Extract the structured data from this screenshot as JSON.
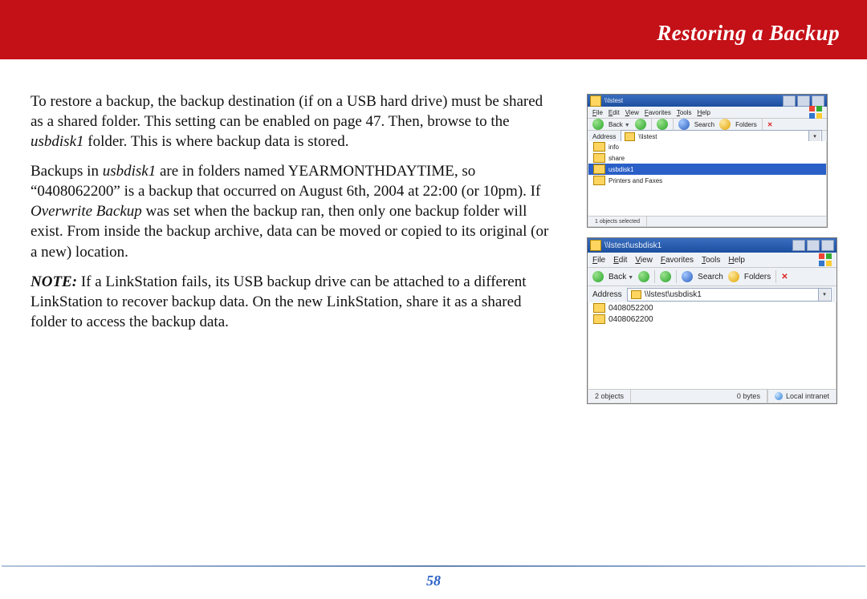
{
  "header": {
    "title": "Restoring a Backup"
  },
  "para1": {
    "a": "To restore a backup, the backup destination (if on a USB hard drive) must be shared as a shared folder.  This setting can be enabled on page 47.  Then, browse to the ",
    "b": "usbdisk1",
    "c": " folder.  This is where backup data is stored."
  },
  "para2": {
    "a": "Backups in ",
    "b": "usbdisk1",
    "c": " are in folders named YEARMONTHDAYTIME, so “0408062200” is a backup that occurred on August 6th, 2004 at 22:00 (or 10pm).  If ",
    "d": "Overwrite Backup",
    "e": " was set when the backup ran, then only one backup folder will exist.  From inside the backup archive, data can be moved or copied to its original (or a new) location."
  },
  "para3": {
    "a": "NOTE:",
    "b": "  If a LinkStation fails, its USB backup drive can be attached to a different LinkStation to recover backup data.  On the new LinkStation, share it as a shared folder to access the backup data."
  },
  "screenshot1": {
    "title": "\\\\lstest",
    "menu": [
      "File",
      "Edit",
      "View",
      "Favorites",
      "Tools",
      "Help"
    ],
    "tb": {
      "back": "Back",
      "search": "Search",
      "folders": "Folders"
    },
    "address_label": "Address",
    "address_value": "\\\\lstest",
    "items": [
      "info",
      "share",
      "usbdisk1",
      "Printers and Faxes"
    ],
    "selected_index": 2,
    "status_left": "1 objects selected"
  },
  "screenshot2": {
    "title": "\\\\lstest\\usbdisk1",
    "menu": [
      "File",
      "Edit",
      "View",
      "Favorites",
      "Tools",
      "Help"
    ],
    "tb": {
      "back": "Back",
      "search": "Search",
      "folders": "Folders"
    },
    "address_label": "Address",
    "address_value": "\\\\lstest\\usbdisk1",
    "items": [
      "0408052200",
      "0408062200"
    ],
    "status_left": "2 objects",
    "status_mid": "0 bytes",
    "status_right": "Local intranet"
  },
  "page_number": "58"
}
